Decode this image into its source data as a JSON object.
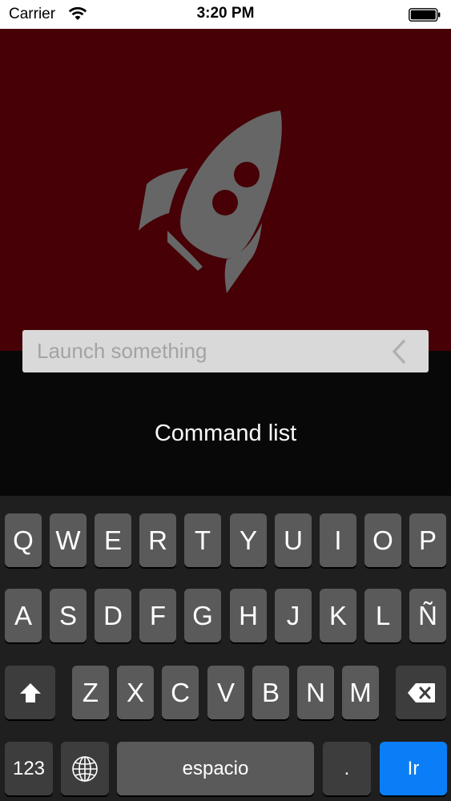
{
  "status_bar": {
    "carrier": "Carrier",
    "time": "3:20 PM"
  },
  "search": {
    "placeholder": "Launch something",
    "value": ""
  },
  "command_list_label": "Command list",
  "keyboard": {
    "row1": [
      "Q",
      "W",
      "E",
      "R",
      "T",
      "Y",
      "U",
      "I",
      "O",
      "P"
    ],
    "row2": [
      "A",
      "S",
      "D",
      "F",
      "G",
      "H",
      "J",
      "K",
      "L",
      "Ñ"
    ],
    "row3": [
      "Z",
      "X",
      "C",
      "V",
      "B",
      "N",
      "M"
    ],
    "numbers_label": "123",
    "space_label": "espacio",
    "period_label": ".",
    "go_label": "Ir"
  },
  "colors": {
    "hero_bg": "#460006",
    "rocket": "#666666",
    "go_key": "#0a7ef7"
  },
  "icons": [
    "wifi-icon",
    "battery-icon",
    "rocket-icon",
    "back-arrow-icon",
    "shift-icon",
    "delete-icon",
    "globe-icon"
  ]
}
